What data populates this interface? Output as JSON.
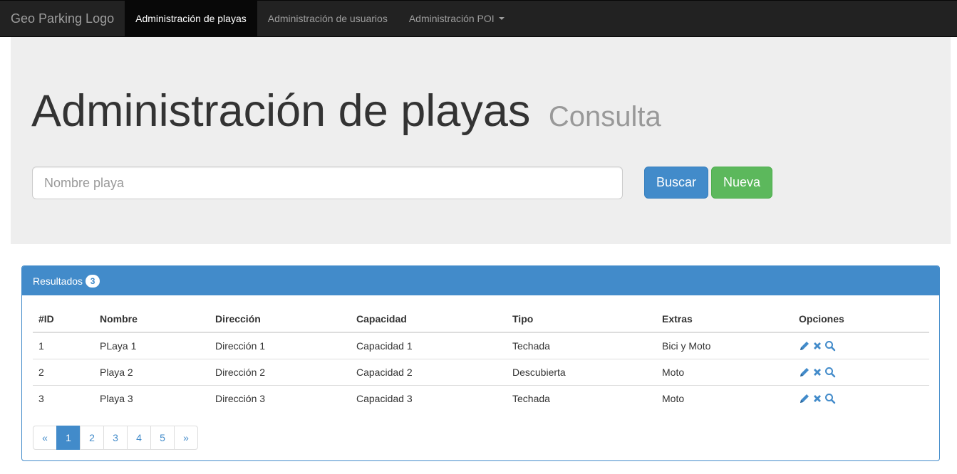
{
  "navbar": {
    "brand": "Geo Parking Logo",
    "items": [
      {
        "label": "Administración de playas",
        "active": true
      },
      {
        "label": "Administración de usuarios",
        "active": false
      },
      {
        "label": "Administración POI",
        "active": false,
        "dropdown": true
      }
    ]
  },
  "jumbotron": {
    "title": "Administración de playas",
    "subtitle": "Consulta",
    "search_placeholder": "Nombre playa",
    "search_value": "",
    "search_button": "Buscar",
    "new_button": "Nueva"
  },
  "results": {
    "heading": "Resultados",
    "count": "3",
    "columns": [
      "#ID",
      "Nombre",
      "Dirección",
      "Capacidad",
      "Tipo",
      "Extras",
      "Opciones"
    ],
    "rows": [
      {
        "id": "1",
        "nombre": "PLaya 1",
        "direccion": "Dirección 1",
        "capacidad": "Capacidad 1",
        "tipo": "Techada",
        "extras": "Bici y Moto"
      },
      {
        "id": "2",
        "nombre": "Playa 2",
        "direccion": "Dirección 2",
        "capacidad": "Capacidad 2",
        "tipo": "Descubierta",
        "extras": "Moto"
      },
      {
        "id": "3",
        "nombre": "Playa 3",
        "direccion": "Dirección 3",
        "capacidad": "Capacidad 3",
        "tipo": "Techada",
        "extras": "Moto"
      }
    ],
    "option_icons": [
      "pencil-icon",
      "remove-icon",
      "search-icon"
    ]
  },
  "pagination": {
    "prev": "«",
    "pages": [
      "1",
      "2",
      "3",
      "4",
      "5"
    ],
    "next": "»",
    "current": "1"
  },
  "colors": {
    "primary": "#428bca",
    "success": "#5cb85c",
    "navbar": "#222222"
  }
}
